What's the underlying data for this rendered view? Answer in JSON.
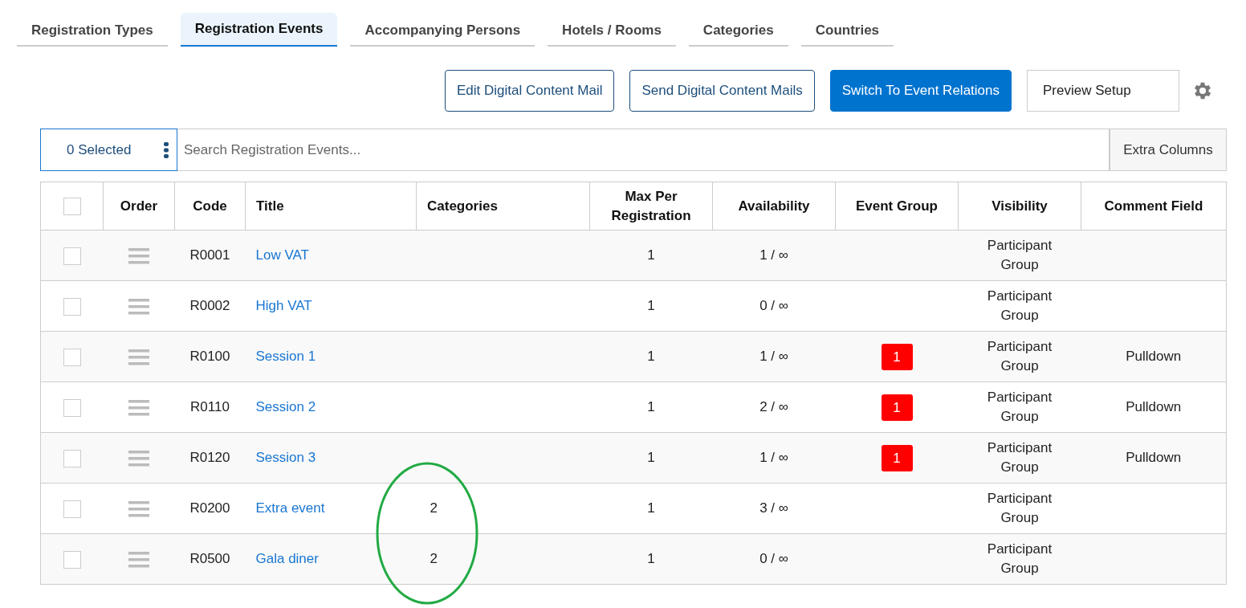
{
  "tabs": [
    {
      "label": "Registration Types",
      "selected": false
    },
    {
      "label": "Registration Events",
      "selected": true
    },
    {
      "label": "Accompanying Persons",
      "selected": false
    },
    {
      "label": "Hotels / Rooms",
      "selected": false
    },
    {
      "label": "Categories",
      "selected": false
    },
    {
      "label": "Countries",
      "selected": false
    }
  ],
  "actions": [
    {
      "label": "Edit Digital Content Mail",
      "kind": "outline"
    },
    {
      "label": "Send Digital Content Mails",
      "kind": "outline"
    },
    {
      "label": "Switch To Event Relations",
      "kind": "primary"
    },
    {
      "label": "Preview Setup",
      "kind": "plain"
    }
  ],
  "selection": {
    "label": "0 Selected"
  },
  "search": {
    "placeholder": "Search Registration Events..."
  },
  "extra_columns": {
    "label": "Extra Columns"
  },
  "table": {
    "header_checked": false,
    "columns": [
      "Order",
      "Code",
      "Title",
      "Categories",
      "Max Per Registration",
      "Availability",
      "Event Group",
      "Visibility",
      "Comment Field"
    ],
    "rows": [
      {
        "checked": false,
        "code": "R0001",
        "title": "Low VAT",
        "categories": "",
        "max": "1",
        "availability": "1 / ∞",
        "event_group": "",
        "visibility": "Participant Group",
        "comment": ""
      },
      {
        "checked": false,
        "code": "R0002",
        "title": "High VAT",
        "categories": "",
        "max": "1",
        "availability": "0 / ∞",
        "event_group": "",
        "visibility": "Participant Group",
        "comment": ""
      },
      {
        "checked": false,
        "code": "R0100",
        "title": "Session 1",
        "categories": "",
        "max": "1",
        "availability": "1 / ∞",
        "event_group": "1",
        "visibility": "Participant Group",
        "comment": "Pulldown"
      },
      {
        "checked": false,
        "code": "R0110",
        "title": "Session 2",
        "categories": "",
        "max": "1",
        "availability": "2 / ∞",
        "event_group": "1",
        "visibility": "Participant Group",
        "comment": "Pulldown"
      },
      {
        "checked": false,
        "code": "R0120",
        "title": "Session 3",
        "categories": "",
        "max": "1",
        "availability": "1 / ∞",
        "event_group": "1",
        "visibility": "Participant Group",
        "comment": "Pulldown"
      },
      {
        "checked": false,
        "code": "R0200",
        "title": "Extra event",
        "categories": "2",
        "max": "1",
        "availability": "3 / ∞",
        "event_group": "",
        "visibility": "Participant Group",
        "comment": ""
      },
      {
        "checked": false,
        "code": "R0500",
        "title": "Gala diner",
        "categories": "2",
        "max": "1",
        "availability": "0 / ∞",
        "event_group": "",
        "visibility": "Participant Group",
        "comment": ""
      }
    ]
  },
  "annotations": [
    {
      "kind": "ellipse",
      "color": "#22aa44"
    }
  ]
}
